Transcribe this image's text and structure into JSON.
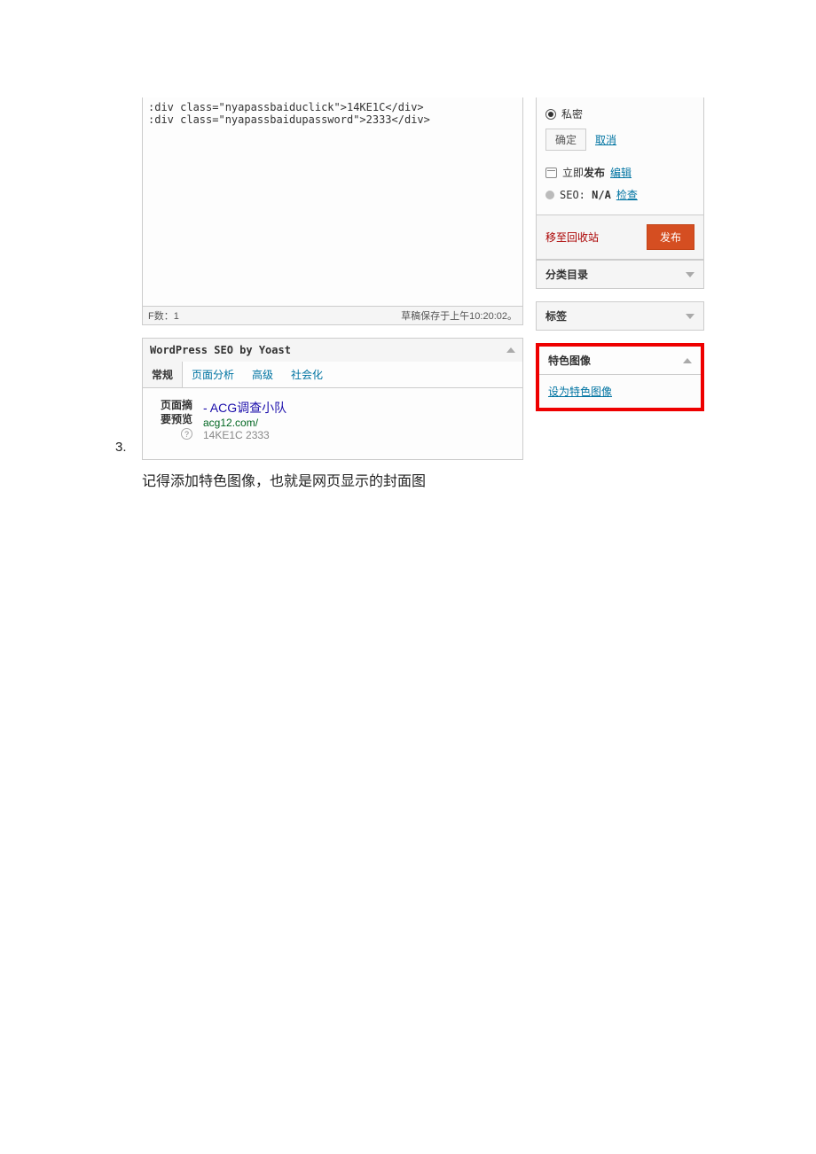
{
  "list_number": "3.",
  "editor": {
    "line1": ":div class=\"nyapassbaiduclick\">14KE1C</div>",
    "line2": ":div class=\"nyapassbaidupassword\">2333</div>",
    "footer_left": "F数：1",
    "footer_right": "草稿保存于上午10:20:02。"
  },
  "seo": {
    "title": "WordPress SEO by Yoast",
    "tabs": [
      "常规",
      "页面分析",
      "高级",
      "社会化"
    ],
    "preview_label": "页面摘要预览",
    "preview_title": " - ACG调查小队",
    "preview_url": "acg12.com/",
    "preview_desc": "14KE1C 2333"
  },
  "publish": {
    "private_label": "私密",
    "ok_label": "确定",
    "cancel_label": "取消",
    "publish_now_prefix": "立即",
    "publish_now_label": "发布",
    "edit_label": "编辑",
    "seo_prefix": "SEO: ",
    "seo_value": "N/A",
    "check_label": "检查",
    "trash_label": "移至回收站",
    "publish_btn": "发布"
  },
  "panels": {
    "categories": "分类目录",
    "tags": "标签",
    "featured_image": "特色图像",
    "set_featured": "设为特色图像"
  },
  "caption": "记得添加特色图像，也就是网页显示的封面图"
}
